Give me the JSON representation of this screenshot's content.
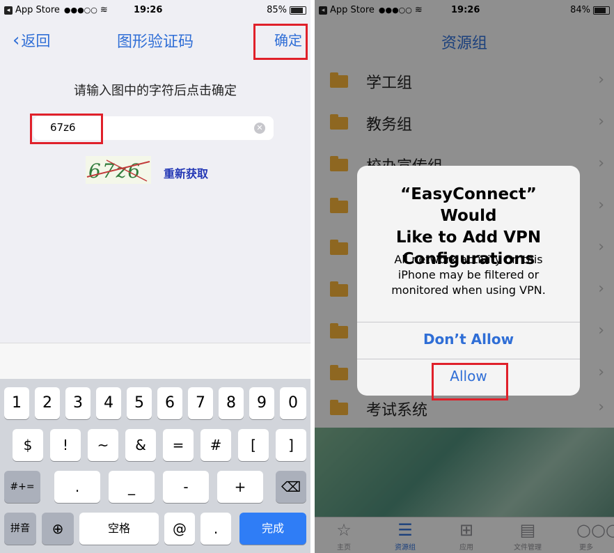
{
  "left": {
    "status": {
      "app": "App Store",
      "signal": "●●●○○",
      "time": "19:26",
      "battery": "85%"
    },
    "nav": {
      "back": "返回",
      "title": "图形验证码",
      "confirm": "确定"
    },
    "prompt": "请输入图中的字符后点击确定",
    "input_value": "67z6",
    "captcha_text": "67z6",
    "refresh": "重新获取",
    "keyboard": {
      "row1": [
        "1",
        "2",
        "3",
        "4",
        "5",
        "6",
        "7",
        "8",
        "9",
        "0"
      ],
      "row2": [
        "$",
        "!",
        "~",
        "&",
        "=",
        "#",
        "[",
        "]"
      ],
      "row3_left": "#+=",
      "row3": [
        ".",
        "_",
        "-",
        "+"
      ],
      "pinyin": "拼音",
      "space": "空格",
      "at": "@",
      "dot": ".",
      "done": "完成"
    }
  },
  "right": {
    "status": {
      "app": "App Store",
      "signal": "●●●○○",
      "time": "19:26",
      "battery": "84%"
    },
    "title": "资源组",
    "rows": [
      "学工组",
      "教务组",
      "校办宣传组",
      "",
      "",
      "",
      "",
      "",
      "考试系统"
    ],
    "alert": {
      "title_line1": "“EasyConnect” Would",
      "title_line2": "Like to Add VPN",
      "title_line3": "Configurations",
      "msg_line1": "All network activity on this",
      "msg_line2": "iPhone may be filtered or",
      "msg_line3": "monitored when using VPN.",
      "deny": "Don’t Allow",
      "allow": "Allow"
    },
    "tabs": [
      "主页",
      "资源组",
      "应用",
      "文件管理",
      "更多"
    ]
  },
  "colors": {
    "accent": "#2f6ed6",
    "highlight": "#e0202a",
    "folder": "#f4b23a"
  }
}
